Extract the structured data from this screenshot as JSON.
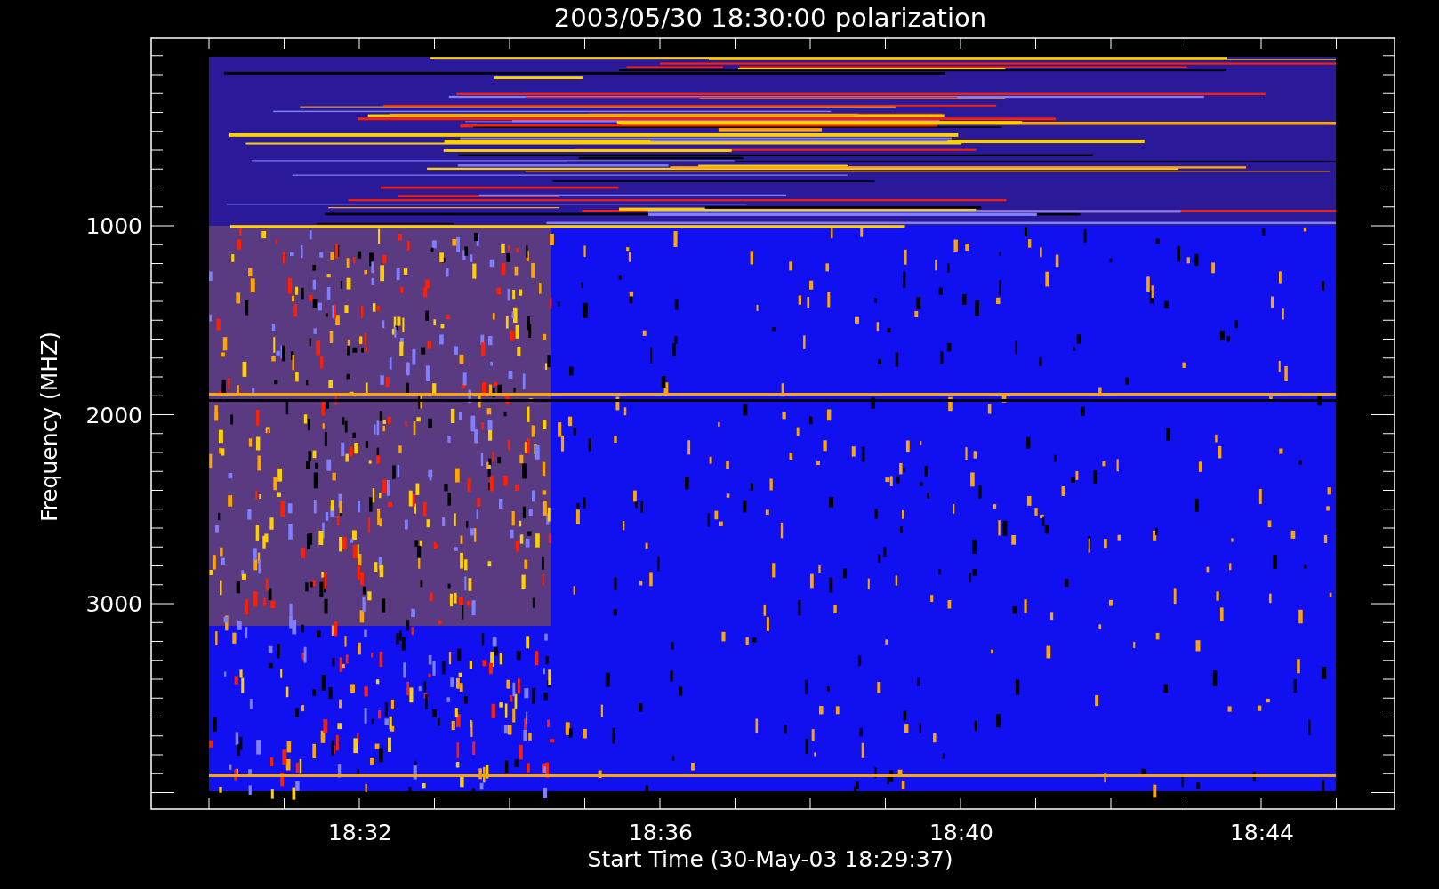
{
  "title": "2003/05/30 18:30:00 polarization",
  "y_axis": {
    "label": "Frequency (MHZ)",
    "tick_labels": [
      "1000",
      "2000",
      "3000"
    ]
  },
  "x_axis": {
    "label": "Start Time (30-May-03 18:29:37)",
    "tick_labels": [
      "18:32",
      "18:36",
      "18:40",
      "18:44"
    ]
  }
}
